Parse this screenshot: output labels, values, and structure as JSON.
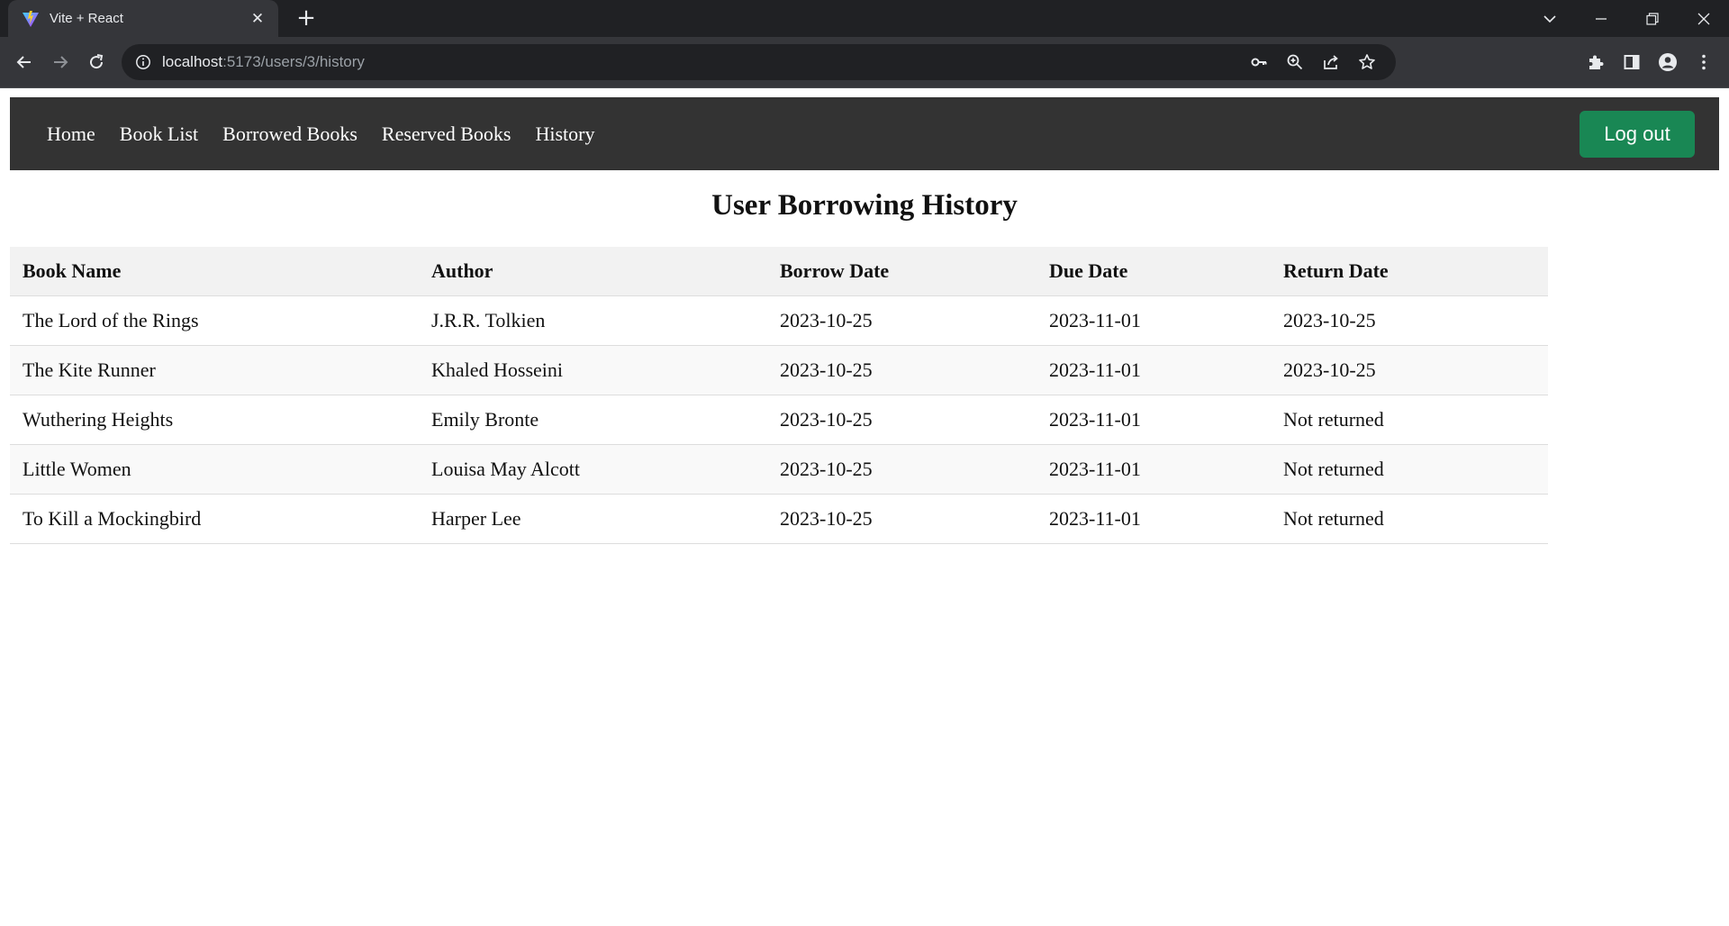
{
  "browser": {
    "tab_title": "Vite + React",
    "url_host": "localhost",
    "url_path": ":5173/users/3/history"
  },
  "nav": {
    "links": [
      "Home",
      "Book List",
      "Borrowed Books",
      "Reserved Books",
      "History"
    ],
    "logout_label": "Log out"
  },
  "page": {
    "title": "User Borrowing History"
  },
  "table": {
    "headers": [
      "Book Name",
      "Author",
      "Borrow Date",
      "Due Date",
      "Return Date"
    ],
    "rows": [
      [
        "The Lord of the Rings",
        "J.R.R. Tolkien",
        "2023-10-25",
        "2023-11-01",
        "2023-10-25"
      ],
      [
        "The Kite Runner",
        "Khaled Hosseini",
        "2023-10-25",
        "2023-11-01",
        "2023-10-25"
      ],
      [
        "Wuthering Heights",
        "Emily Bronte",
        "2023-10-25",
        "2023-11-01",
        "Not returned"
      ],
      [
        "Little Women",
        "Louisa May Alcott",
        "2023-10-25",
        "2023-11-01",
        "Not returned"
      ],
      [
        "To Kill a Mockingbird",
        "Harper Lee",
        "2023-10-25",
        "2023-11-01",
        "Not returned"
      ]
    ]
  },
  "colors": {
    "navbar_bg": "#333333",
    "logout_bg": "#198754",
    "header_row_bg": "#f2f2f2",
    "stripe_bg": "#f9f9f9"
  }
}
